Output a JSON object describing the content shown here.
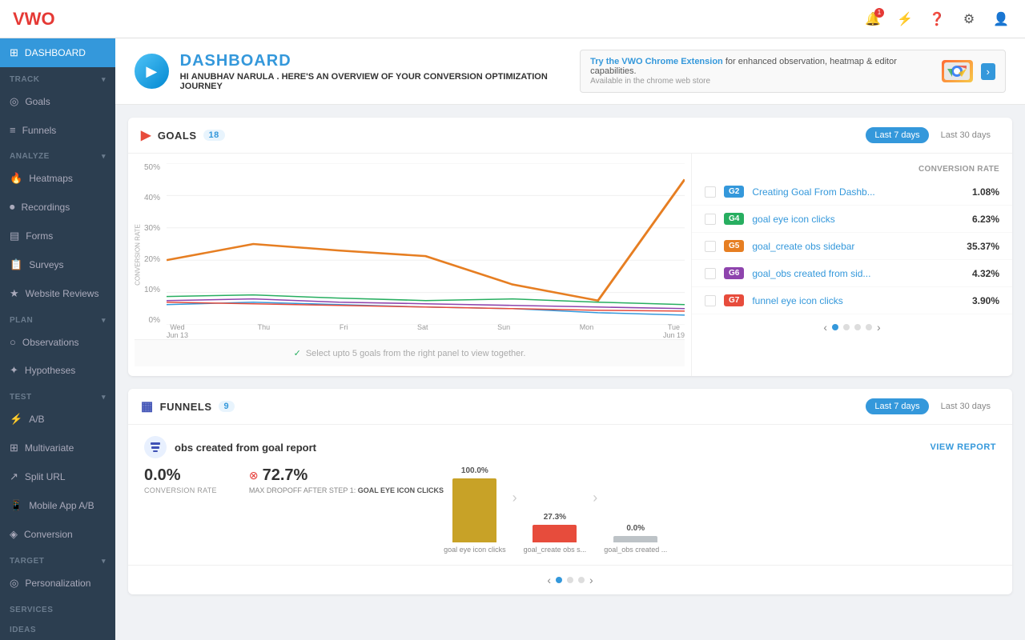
{
  "topbar": {
    "logo": "VWO",
    "icons": [
      "bell",
      "pulse",
      "help",
      "settings",
      "user"
    ]
  },
  "sidebar": {
    "active": "dashboard",
    "items": [
      {
        "id": "dashboard",
        "label": "DASHBOARD",
        "icon": "⊞",
        "active": true
      },
      {
        "id": "track",
        "label": "TRACK",
        "icon": "",
        "section": true
      },
      {
        "id": "goals",
        "label": "Goals",
        "icon": "◎",
        "indent": true
      },
      {
        "id": "funnels",
        "label": "Funnels",
        "icon": "≡",
        "indent": true
      },
      {
        "id": "analyze",
        "label": "ANALYZE",
        "icon": "",
        "section": true
      },
      {
        "id": "heatmaps",
        "label": "Heatmaps",
        "icon": "🔥",
        "indent": true
      },
      {
        "id": "recordings",
        "label": "Recordings",
        "icon": "⏺",
        "indent": true
      },
      {
        "id": "forms",
        "label": "Forms",
        "icon": "▤",
        "indent": true
      },
      {
        "id": "surveys",
        "label": "Surveys",
        "icon": "📋",
        "indent": true
      },
      {
        "id": "website-reviews",
        "label": "Website Reviews",
        "icon": "★",
        "indent": true
      },
      {
        "id": "plan",
        "label": "PLAN",
        "icon": "",
        "section": true
      },
      {
        "id": "observations",
        "label": "Observations",
        "icon": "○",
        "indent": true
      },
      {
        "id": "hypotheses",
        "label": "Hypotheses",
        "icon": "✦",
        "indent": true
      },
      {
        "id": "test",
        "label": "TEST",
        "icon": "",
        "section": true
      },
      {
        "id": "ab",
        "label": "A/B",
        "icon": "⚡",
        "indent": true
      },
      {
        "id": "multivariate",
        "label": "Multivariate",
        "icon": "⊞",
        "indent": true
      },
      {
        "id": "split-url",
        "label": "Split URL",
        "icon": "↗",
        "indent": true
      },
      {
        "id": "mobile-ab",
        "label": "Mobile App A/B",
        "icon": "📱",
        "indent": true
      },
      {
        "id": "conversion",
        "label": "Conversion",
        "icon": "◈",
        "indent": true
      },
      {
        "id": "target",
        "label": "TARGET",
        "icon": "",
        "section": true
      },
      {
        "id": "personalization",
        "label": "Personalization",
        "icon": "◎",
        "indent": true
      },
      {
        "id": "services",
        "label": "SERVICES",
        "icon": "",
        "section": true
      },
      {
        "id": "ideas",
        "label": "IDEAS",
        "icon": "",
        "section": true
      }
    ]
  },
  "header": {
    "title": "DASHBOARD",
    "subtitle_pre": "HI",
    "user": "ANUBHAV NARULA",
    "subtitle_post": ". HERE'S AN OVERVIEW OF YOUR CONVERSION OPTIMIZATION JOURNEY",
    "banner_link": "Try the VWO Chrome Extension",
    "banner_text": " for enhanced observation, heatmap & editor capabilities.",
    "banner_cta": "Available in the chrome web store",
    "chrome_label": "Chrome"
  },
  "goals_card": {
    "title": "GOALS",
    "count": "18",
    "time_active": "Last 7 days",
    "time_inactive": "Last 30 days",
    "y_labels": [
      "50%",
      "40%",
      "30%",
      "20%",
      "10%",
      "0%"
    ],
    "x_labels": [
      {
        "day": "Wed",
        "date": "Jun 13"
      },
      {
        "day": "Thu",
        "date": ""
      },
      {
        "day": "Fri",
        "date": ""
      },
      {
        "day": "Sat",
        "date": ""
      },
      {
        "day": "Sun",
        "date": ""
      },
      {
        "day": "Mon",
        "date": ""
      },
      {
        "day": "Tue",
        "date": "Jun 19"
      }
    ],
    "conversion_rate_label": "CONVERSION RATE",
    "chart_note": "Select upto 5 goals from the right panel to view together.",
    "goals": [
      {
        "tag": "G2",
        "tag_color": "#3498db",
        "name": "Creating Goal From Dashb...",
        "rate": "1.08%"
      },
      {
        "tag": "G4",
        "tag_color": "#27ae60",
        "name": "goal eye icon clicks",
        "rate": "6.23%"
      },
      {
        "tag": "G5",
        "tag_color": "#e67e22",
        "name": "goal_create obs sidebar",
        "rate": "35.37%"
      },
      {
        "tag": "G6",
        "tag_color": "#8e44ad",
        "name": "goal_obs created from sid...",
        "rate": "4.32%"
      },
      {
        "tag": "G7",
        "tag_color": "#e74c3c",
        "name": "funnel eye icon clicks",
        "rate": "3.90%"
      }
    ],
    "column_label": "CONVERSION RATE"
  },
  "funnels_card": {
    "title": "FUNNELS",
    "count": "9",
    "time_active": "Last 7 days",
    "time_inactive": "Last 30 days",
    "funnel_name": "obs created from goal report",
    "view_report": "VIEW REPORT",
    "conversion_rate": "0.0%",
    "conversion_label": "CONVERSION RATE",
    "dropoff_value": "72.7%",
    "dropoff_label": "MAX DROPOFF AFTER STEP 1:",
    "dropoff_step": "GOAL EYE ICON CLICKS",
    "bars": [
      {
        "pct": "100.0%",
        "height": 80,
        "color": "#c8a227",
        "label": "goal eye icon clicks"
      },
      {
        "pct": "27.3%",
        "height": 22,
        "color": "#e74c3c",
        "label": "goal_create obs s..."
      },
      {
        "pct": "0.0%",
        "height": 8,
        "color": "#bdc3c7",
        "label": "goal_obs created ..."
      }
    ]
  }
}
